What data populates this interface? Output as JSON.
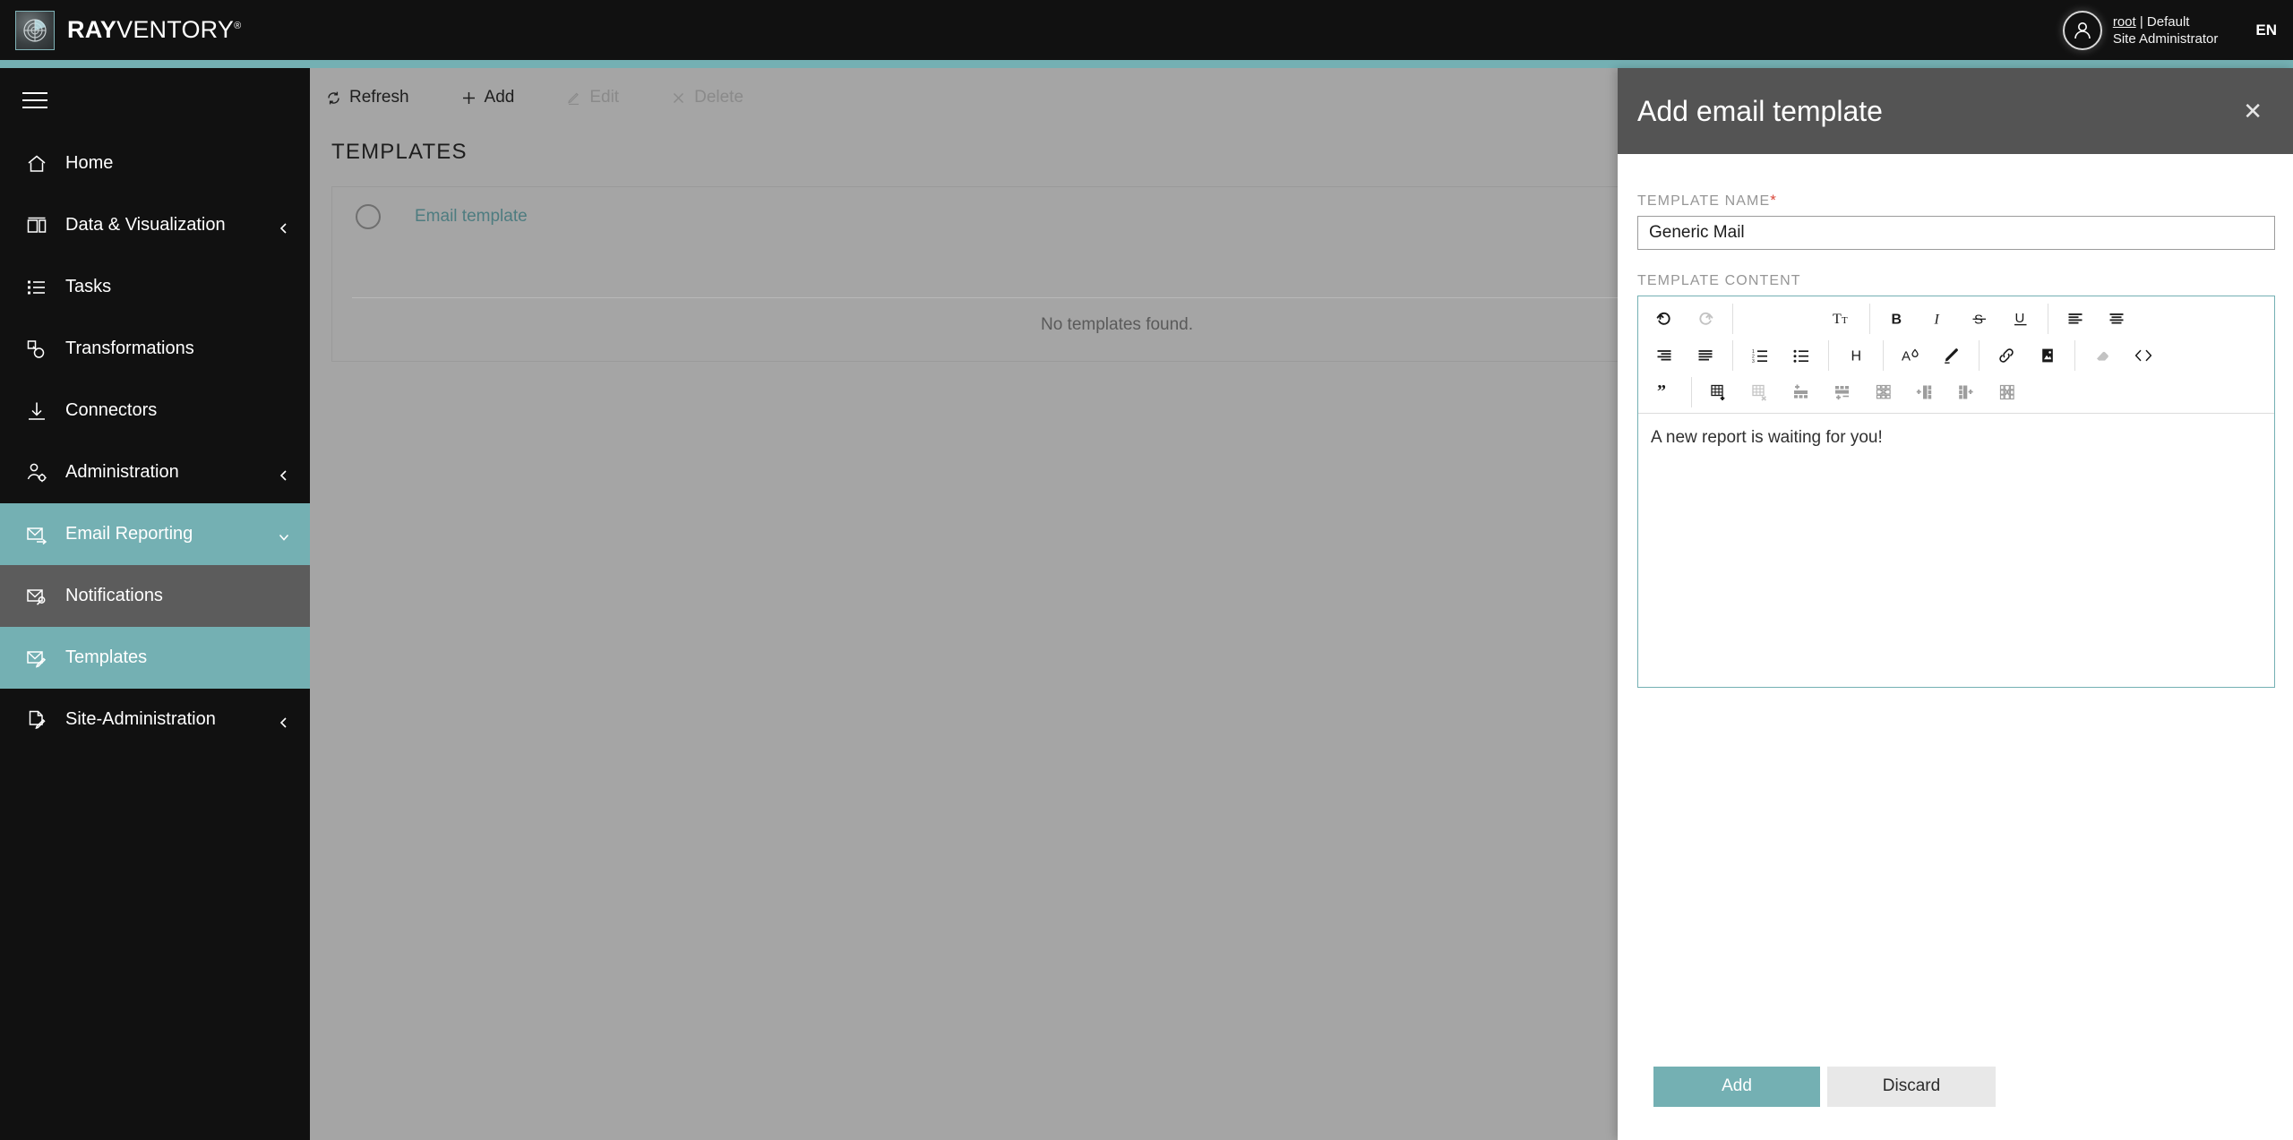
{
  "brand": {
    "bold": "RAY",
    "light": "VENTORY",
    "trademark": "®",
    "logo_icon": "radar-icon"
  },
  "header": {
    "user_line1_name": "root",
    "user_line1_rest": " | Default",
    "user_line2": "Site Administrator",
    "language": "EN",
    "avatar_icon": "user-avatar-icon"
  },
  "sidebar": {
    "menu_icon": "hamburger-icon",
    "items": [
      {
        "label": "Home",
        "icon": "home-icon",
        "state": "default",
        "chevron": ""
      },
      {
        "label": "Data & Visualization",
        "icon": "dashboard-icon",
        "state": "default",
        "chevron": "left"
      },
      {
        "label": "Tasks",
        "icon": "list-icon",
        "state": "default",
        "chevron": ""
      },
      {
        "label": "Transformations",
        "icon": "transform-icon",
        "state": "default",
        "chevron": ""
      },
      {
        "label": "Connectors",
        "icon": "download-icon",
        "state": "default",
        "chevron": ""
      },
      {
        "label": "Administration",
        "icon": "user-gear-icon",
        "state": "default",
        "chevron": "left"
      },
      {
        "label": "Email Reporting",
        "icon": "mail-send-icon",
        "state": "teal",
        "chevron": "down"
      },
      {
        "label": "Notifications",
        "icon": "mail-bell-icon",
        "state": "gray",
        "chevron": ""
      },
      {
        "label": "Templates",
        "icon": "mail-edit-icon",
        "state": "teal",
        "chevron": ""
      },
      {
        "label": "Site-Administration",
        "icon": "page-edit-icon",
        "state": "default",
        "chevron": "left"
      }
    ]
  },
  "toolbar": {
    "refresh": "Refresh",
    "add": "Add",
    "edit": "Edit",
    "delete": "Delete"
  },
  "main": {
    "page_title": "TEMPLATES",
    "list_column_header": "Email template",
    "empty_message": "No templates found."
  },
  "drawer": {
    "title": "Add email template",
    "close_icon": "close-icon",
    "name_label": "TEMPLATE NAME",
    "name_required_mark": "*",
    "name_value": "Generic Mail",
    "name_placeholder": "",
    "content_label": "TEMPLATE CONTENT",
    "content_value": "A new report is waiting for you!",
    "add_button": "Add",
    "discard_button": "Discard",
    "editor_toolbar": {
      "row1": [
        {
          "icon": "undo-icon",
          "state": "active"
        },
        {
          "icon": "redo-icon",
          "state": "disabled"
        },
        {
          "icon": "separator",
          "state": "sep"
        },
        {
          "icon": "spacer",
          "state": "spacer"
        },
        {
          "icon": "spacer",
          "state": "spacer"
        },
        {
          "icon": "font-size-icon",
          "state": "active"
        },
        {
          "icon": "separator",
          "state": "sep"
        },
        {
          "icon": "bold-icon",
          "state": "active"
        },
        {
          "icon": "italic-icon",
          "state": "active"
        },
        {
          "icon": "strikethrough-icon",
          "state": "active"
        },
        {
          "icon": "underline-icon",
          "state": "active"
        },
        {
          "icon": "separator",
          "state": "sep"
        },
        {
          "icon": "align-left-icon",
          "state": "active"
        },
        {
          "icon": "align-center-icon",
          "state": "active"
        }
      ],
      "row2": [
        {
          "icon": "align-right-icon",
          "state": "active"
        },
        {
          "icon": "align-justify-icon",
          "state": "active"
        },
        {
          "icon": "separator",
          "state": "sep"
        },
        {
          "icon": "ordered-list-icon",
          "state": "active"
        },
        {
          "icon": "unordered-list-icon",
          "state": "active"
        },
        {
          "icon": "separator",
          "state": "sep"
        },
        {
          "icon": "heading-icon",
          "state": "active"
        },
        {
          "icon": "separator",
          "state": "sep"
        },
        {
          "icon": "text-color-icon",
          "state": "active"
        },
        {
          "icon": "highlight-icon",
          "state": "active"
        },
        {
          "icon": "separator",
          "state": "sep"
        },
        {
          "icon": "link-icon",
          "state": "active"
        },
        {
          "icon": "image-icon",
          "state": "active"
        },
        {
          "icon": "separator",
          "state": "sep"
        },
        {
          "icon": "eraser-icon",
          "state": "disabled"
        },
        {
          "icon": "code-icon",
          "state": "active"
        }
      ],
      "row3": [
        {
          "icon": "blockquote-icon",
          "state": "active"
        },
        {
          "icon": "separator",
          "state": "sep"
        },
        {
          "icon": "table-insert-icon",
          "state": "active"
        },
        {
          "icon": "table-delete-icon",
          "state": "disabled"
        },
        {
          "icon": "row-insert-above-icon",
          "state": "mid"
        },
        {
          "icon": "row-insert-below-icon",
          "state": "mid"
        },
        {
          "icon": "row-delete-icon",
          "state": "mid"
        },
        {
          "icon": "column-insert-left-icon",
          "state": "mid"
        },
        {
          "icon": "column-insert-right-icon",
          "state": "mid"
        },
        {
          "icon": "column-delete-icon",
          "state": "mid"
        }
      ]
    }
  },
  "colors": {
    "accent_teal": "#74b0b3",
    "topbar_black": "#111111",
    "content_gray": "#a5a5a5",
    "drawer_header_gray": "#545454",
    "active_nav_gray": "#5c5c5c",
    "link_teal": "#4e7c80",
    "required_red": "#d9483b"
  }
}
